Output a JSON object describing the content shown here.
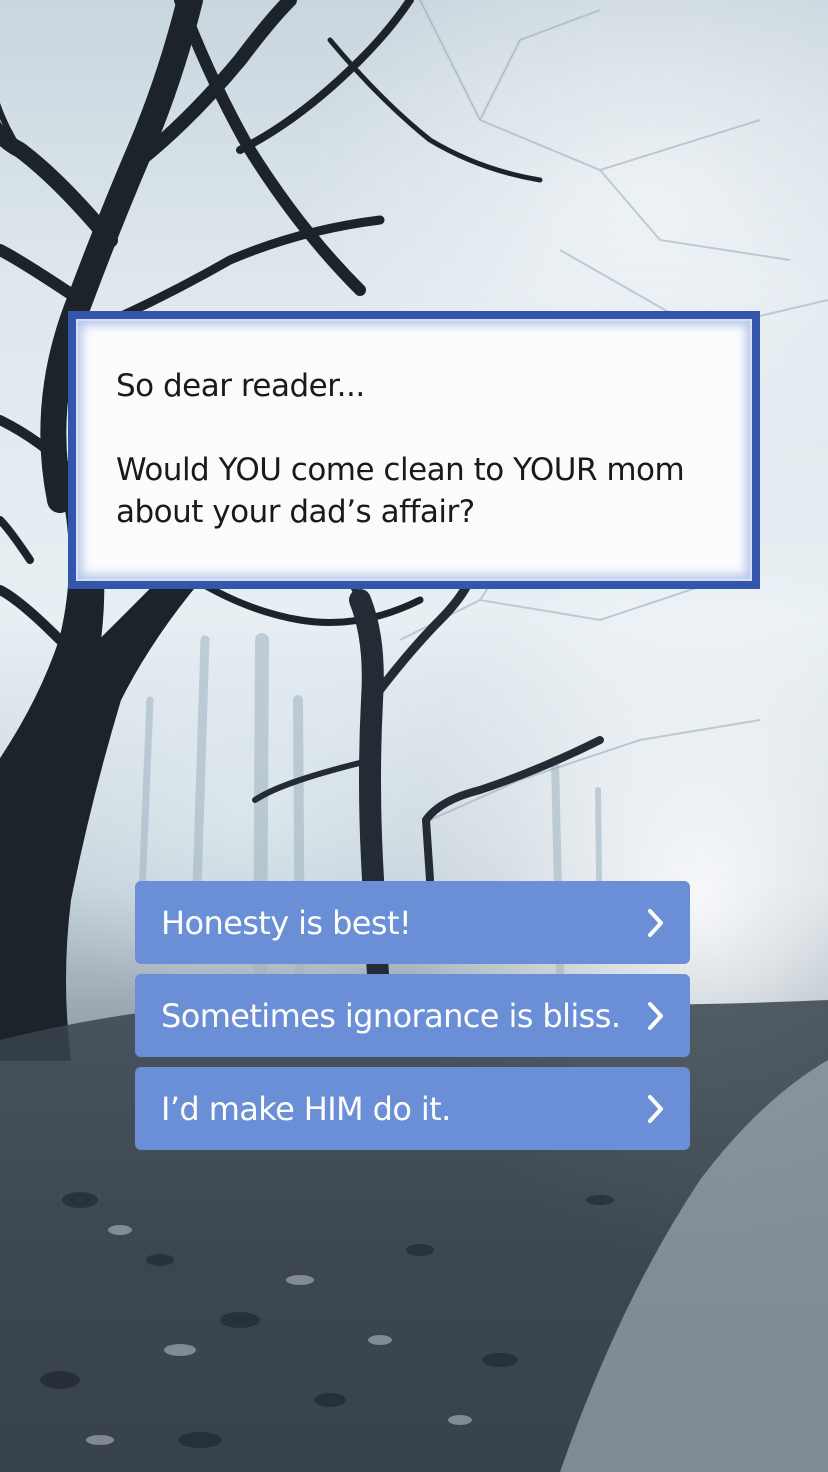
{
  "scene": {
    "background": "misty-forest",
    "accent_color": "#3355aa",
    "button_color": "#6a8fd6"
  },
  "dialog": {
    "line1": "So dear reader...",
    "line2": "Would YOU come clean to YOUR mom",
    "line3": "about your dad’s affair?"
  },
  "choices": [
    {
      "label": "Honesty is best!",
      "icon": "chevron-right-icon"
    },
    {
      "label": "Sometimes ignorance is bliss.",
      "icon": "chevron-right-icon"
    },
    {
      "label": "I’d make HIM do it.",
      "icon": "chevron-right-icon"
    }
  ]
}
